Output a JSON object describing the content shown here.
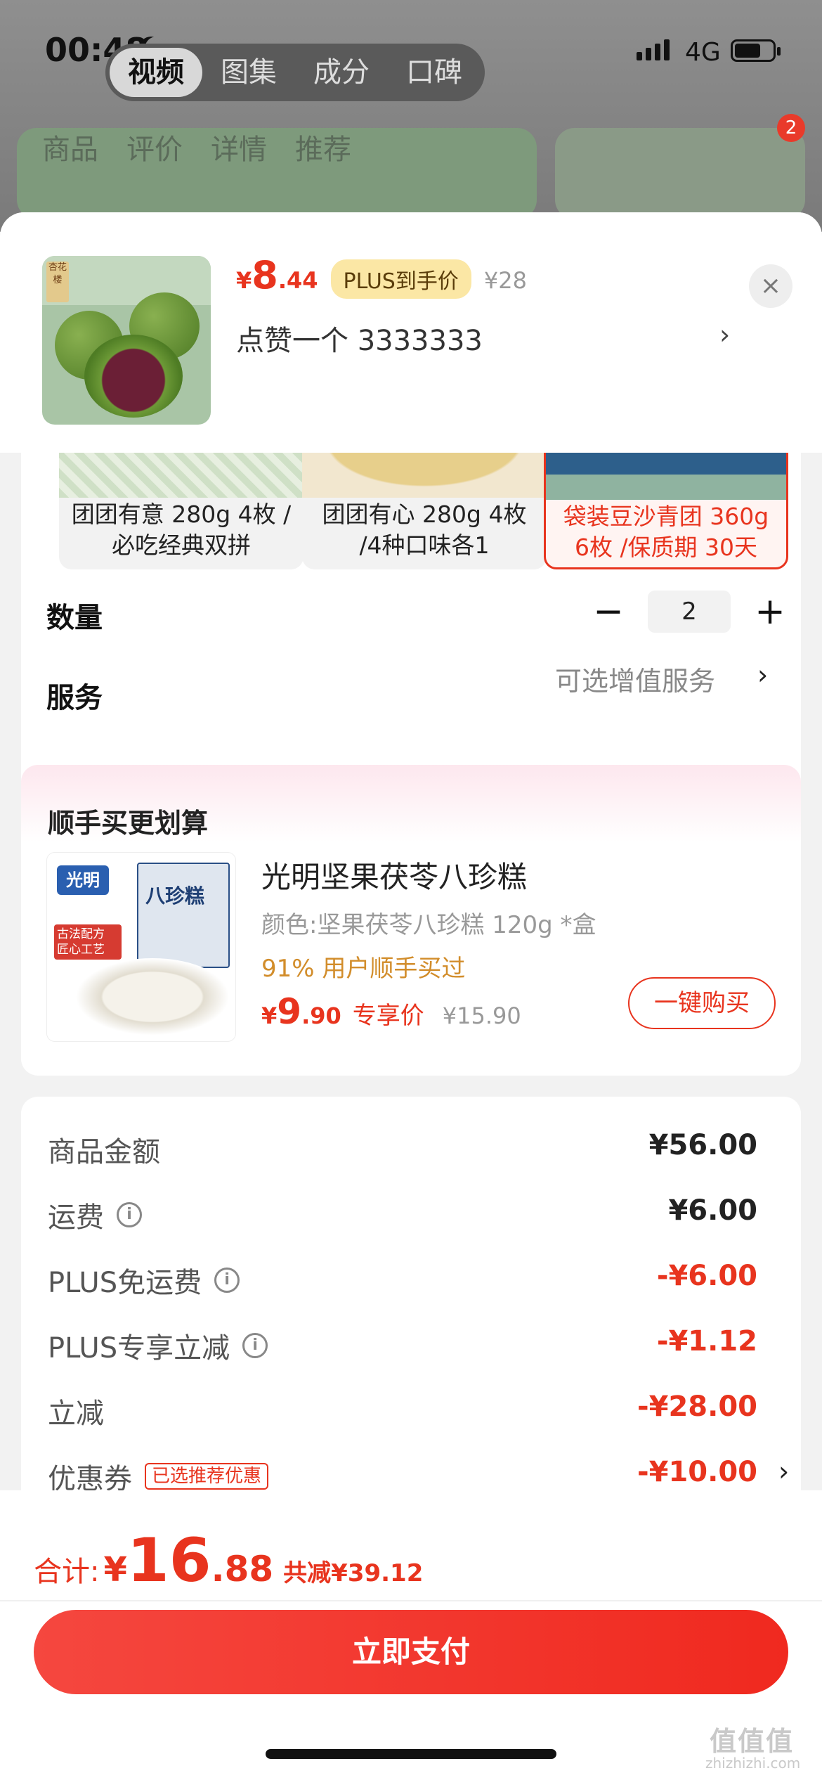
{
  "status_bar": {
    "time": "00:48",
    "network": "4G",
    "signal_bars": 4,
    "battery_level": 0.7
  },
  "media_tabs": [
    {
      "label": "视频",
      "active": true
    },
    {
      "label": "图集",
      "active": false
    },
    {
      "label": "成分",
      "active": false
    },
    {
      "label": "口碑",
      "active": false
    }
  ],
  "background_nav": {
    "items": [
      "商品",
      "评价",
      "详情",
      "推荐"
    ],
    "cart_badge": "2"
  },
  "product": {
    "price_yen": "¥",
    "price_int": "8",
    "price_dec": ".44",
    "plus_badge": "PLUS到手价",
    "original_price": "¥28",
    "selected_spec": "点赞一个  3333333",
    "chevron": "›",
    "close": "×",
    "thumb_brand": "杏花楼"
  },
  "spec_options": [
    {
      "label": "团团有意 280g 4枚 /必吃经典双拼",
      "selected": false
    },
    {
      "label": "团团有心 280g 4枚 /4种口味各1",
      "selected": false
    },
    {
      "label": "袋装豆沙青团 360g 6枚 /保质期 30天",
      "selected": true
    }
  ],
  "quantity": {
    "label": "数量",
    "minus": "−",
    "value": "2",
    "plus": "+"
  },
  "service": {
    "label": "服务",
    "value": "可选增值服务",
    "chevron": "›"
  },
  "addon": {
    "section_title": "顺手买更划算",
    "image_brand": "光明",
    "image_title": "八珍糕",
    "image_sub": "古法配方 匠心工艺",
    "name": "光明坚果茯苓八珍糕",
    "spec": "颜色:坚果茯苓八珍糕 120g *盒",
    "stat": "91% 用户顺手买过",
    "price_yen": "¥",
    "price_int": "9",
    "price_dec": ".90",
    "price_tag": "专享价",
    "original_price": "¥15.90",
    "buy_label": "一键购买"
  },
  "fees": [
    {
      "label": "商品金额",
      "value": "¥56.00",
      "info": false,
      "red": false
    },
    {
      "label": "运费",
      "value": "¥6.00",
      "info": true,
      "red": false
    },
    {
      "label": "PLUS免运费",
      "value": "-¥6.00",
      "info": true,
      "red": true
    },
    {
      "label": "PLUS专享立减",
      "value": "-¥1.12",
      "info": true,
      "red": true
    },
    {
      "label": "立减",
      "value": "-¥28.00",
      "info": false,
      "red": true
    },
    {
      "label": "优惠券",
      "value": "-¥10.00",
      "info": false,
      "red": true,
      "tag": "已选推荐优惠",
      "chevron": "›"
    }
  ],
  "footer": {
    "total_label": "合计:",
    "total_yen": "¥",
    "total_int": "16",
    "total_dec": ".88",
    "saved": "共减¥39.12",
    "pay_label": "立即支付"
  },
  "watermark": {
    "text": "值值值",
    "sub": "zhizhizhi.com"
  },
  "colors": {
    "accent": "#e8341e",
    "plus_badge_bg": "#fbe7a5",
    "addon_stat": "#d28d2b"
  }
}
